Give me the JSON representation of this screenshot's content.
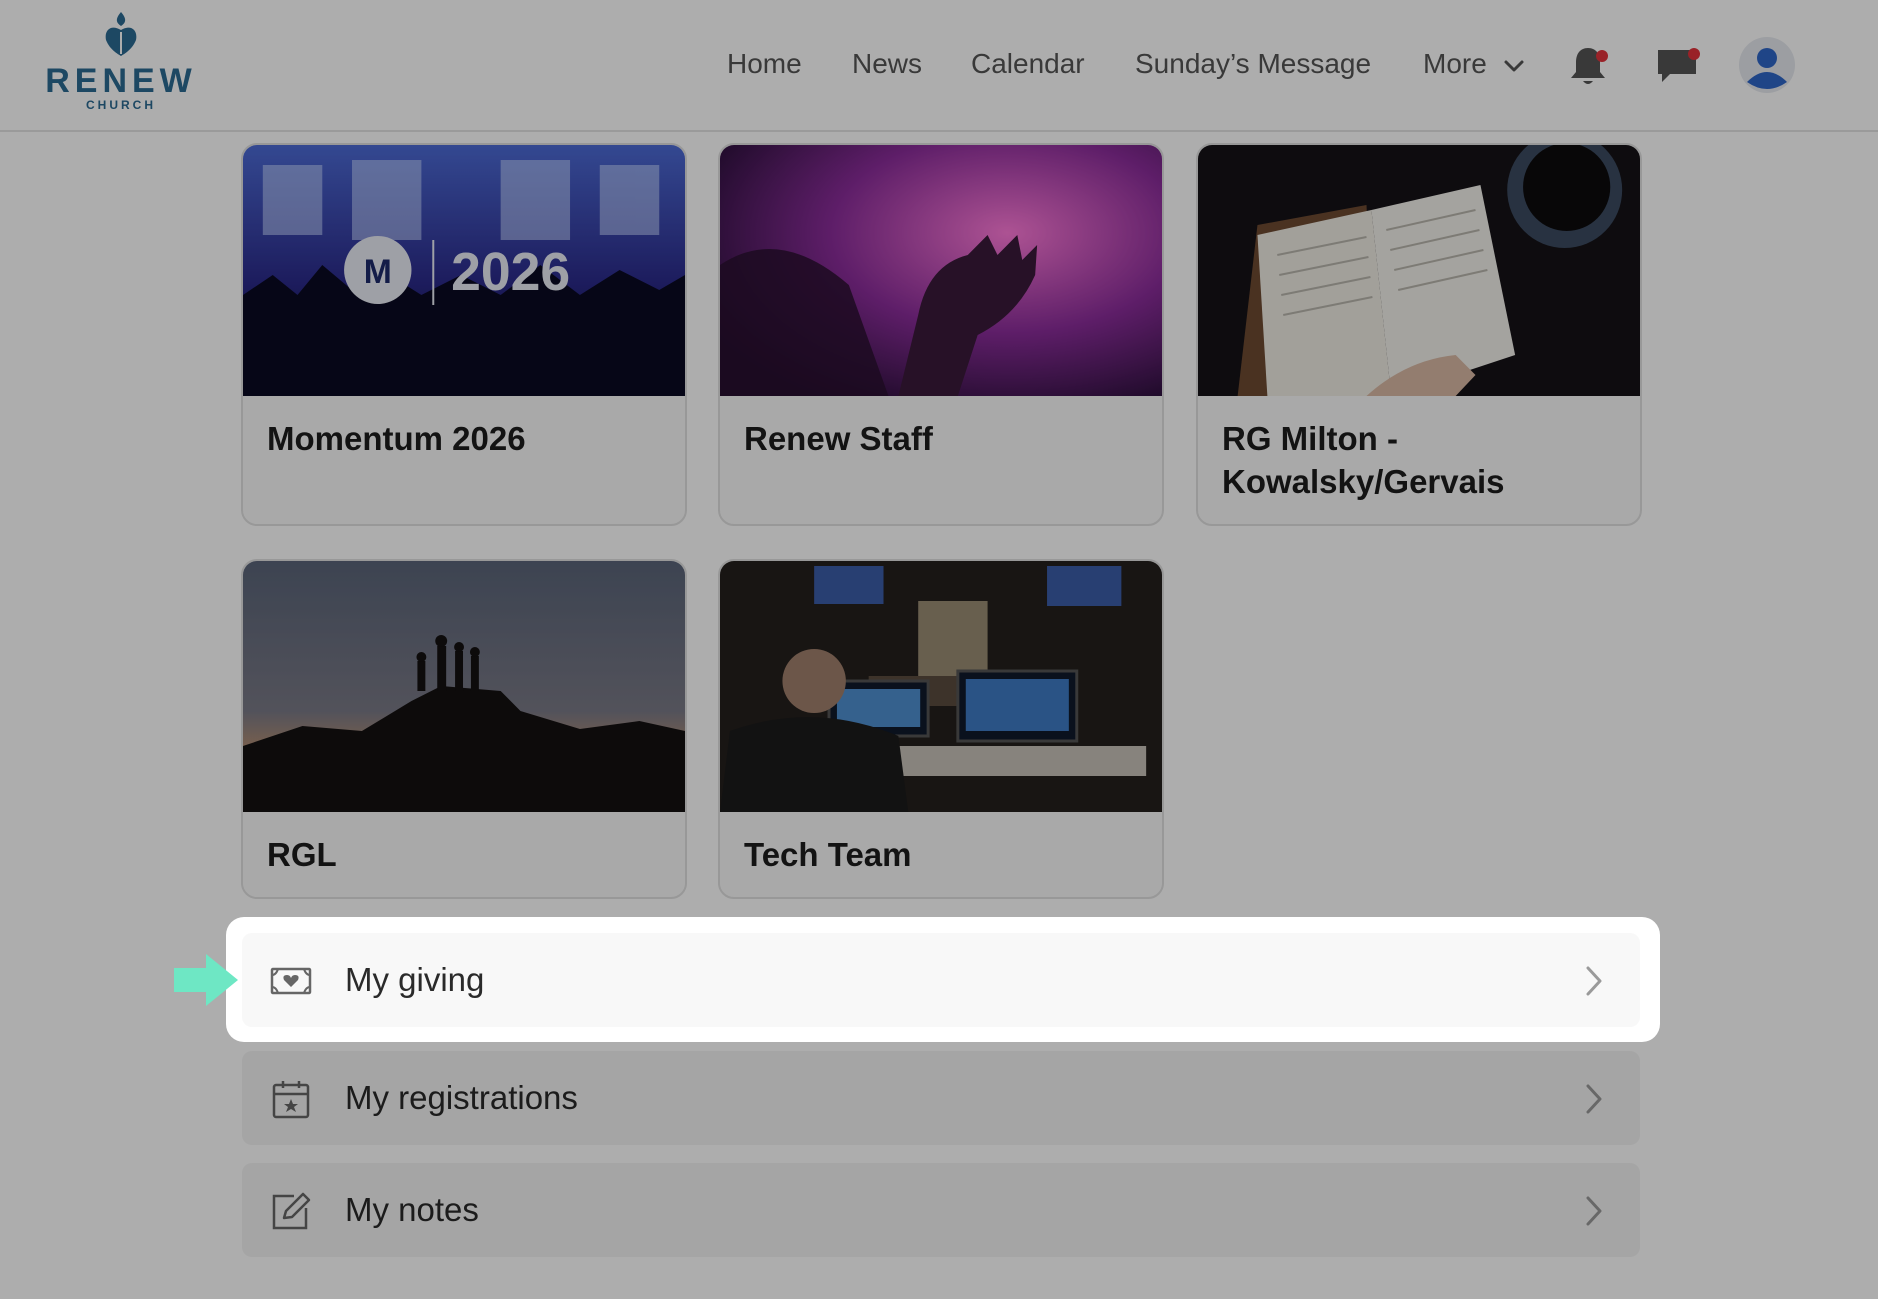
{
  "brand": {
    "name": "RENEW",
    "subtitle": "CHURCH",
    "color": "#2c6a92"
  },
  "nav": {
    "links": [
      "Home",
      "News",
      "Calendar",
      "Sunday’s Message"
    ],
    "more_label": "More",
    "notification_icon": "bell-icon",
    "messages_icon": "chat-icon",
    "avatar_icon": "user-avatar-icon",
    "badge_color": "#e2333b"
  },
  "groups": [
    {
      "title": "Momentum 2026",
      "image": "momentum-2026-graphic",
      "image_text": "2026"
    },
    {
      "title": "Renew Staff",
      "image": "raised-hand-photo"
    },
    {
      "title": "RG Milton - Kowalsky/Gervais",
      "image": "bible-and-coffee-photo"
    },
    {
      "title": "RGL",
      "image": "mountain-silhouette-photo"
    },
    {
      "title": "Tech Team",
      "image": "tech-booth-photo"
    }
  ],
  "menu": [
    {
      "label": "My giving",
      "icon": "giving-heart-icon",
      "highlighted": true
    },
    {
      "label": "My registrations",
      "icon": "calendar-star-icon",
      "highlighted": false
    },
    {
      "label": "My notes",
      "icon": "edit-note-icon",
      "highlighted": false
    }
  ],
  "tutorial_arrow_color": "#6ee7c4"
}
